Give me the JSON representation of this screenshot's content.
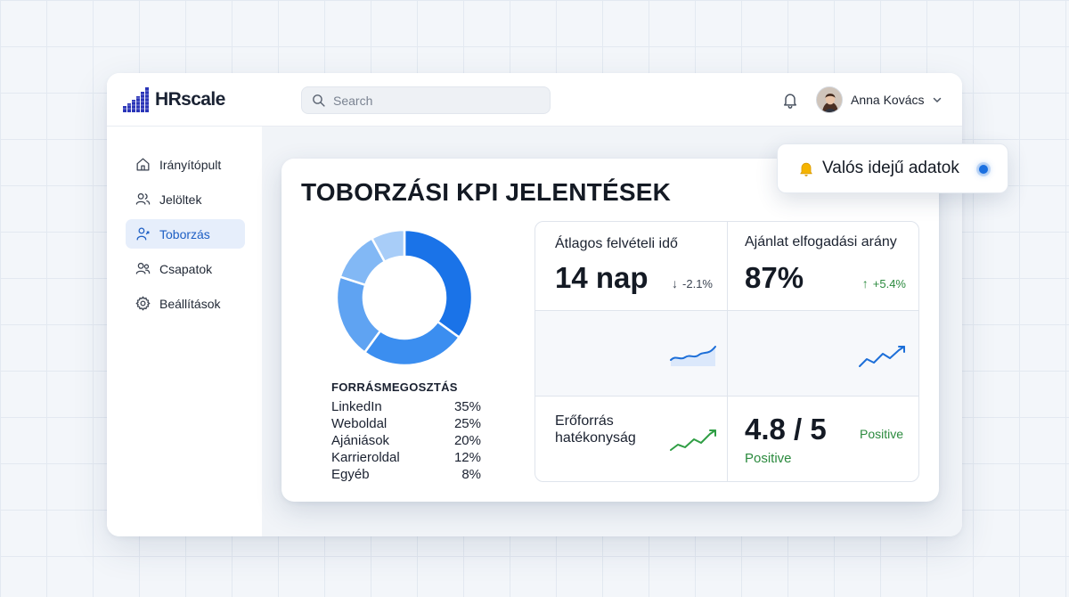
{
  "app": {
    "name": "HRscale"
  },
  "colors": {
    "accent": "#1a6fe0",
    "positive": "#2b8a3e",
    "active_nav_bg": "#e6eefb"
  },
  "search": {
    "placeholder": "Search",
    "icon": "search-icon"
  },
  "header": {
    "notification_icon": "bell-icon"
  },
  "user": {
    "name": "Anna Kovács",
    "avatar_icon": "avatar",
    "menu_icon": "chevron-down-icon"
  },
  "sidebar": {
    "items": [
      {
        "label": "Irányítópult",
        "icon": "home-icon",
        "active": false
      },
      {
        "label": "Jelöltek",
        "icon": "users-icon",
        "active": false
      },
      {
        "label": "Toborzás",
        "icon": "recruit-icon",
        "active": true
      },
      {
        "label": "Csapatok",
        "icon": "team-icon",
        "active": false
      },
      {
        "label": "Beállítások",
        "icon": "gear-icon",
        "active": false
      }
    ]
  },
  "report": {
    "title": "TOBORZÁSI KPI JELENTÉSEK",
    "sources": {
      "heading": "FORRÁSMEGOSZTÁS",
      "rows": [
        {
          "name": "LinkedIn",
          "value": "35%"
        },
        {
          "name": "Weboldal",
          "value": "25%"
        },
        {
          "name": "Ajániások",
          "value": "20%"
        },
        {
          "name": "Karrieroldal",
          "value": "12%"
        },
        {
          "name": "Egyéb",
          "value": "8%"
        }
      ]
    },
    "kpis": {
      "avg_hiring_time": {
        "label": "Átlagos felvételi idő",
        "value": "14 nap",
        "delta": "-2.1%",
        "direction": "down"
      },
      "offer_acceptance": {
        "label": "Ajánlat elfogadási arány",
        "value": "87%",
        "delta": "+5.4%",
        "direction": "up"
      },
      "resource_efficiency": {
        "label": "Erőforrás hatékonyság"
      },
      "rating": {
        "value": "4.8 / 5",
        "sub_label": "Positive",
        "badge": "Positive"
      }
    }
  },
  "realtime": {
    "label": "Valós idejű adatok",
    "icon": "bell-icon"
  },
  "chart_data": {
    "type": "pie",
    "variant": "donut",
    "categories": [
      "LinkedIn",
      "Weboldal",
      "Ajániások",
      "Karrieroldal",
      "Egyéb"
    ],
    "values": [
      35,
      25,
      20,
      12,
      8
    ],
    "unit": "%",
    "colors": [
      "#1a73e8",
      "#3b8ef0",
      "#5fa3f2",
      "#82b8f5",
      "#a8cdf8"
    ]
  }
}
